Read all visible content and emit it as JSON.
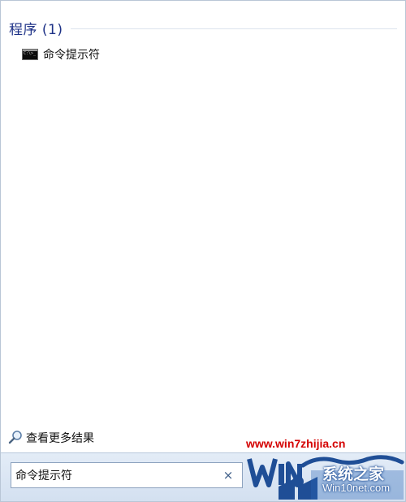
{
  "results": {
    "group_title": "程序 (1)",
    "items": [
      {
        "label": "命令提示符",
        "icon": "command-prompt-icon"
      }
    ],
    "see_more_label": "查看更多结果"
  },
  "search": {
    "value": "命令提示符",
    "clear_symbol": "×"
  },
  "watermark": {
    "url": "www.win7zhijia.cn",
    "brand": "系统之家",
    "domain": "Win10net.com"
  },
  "colors": {
    "group_title": "#1e3287",
    "watermark_url": "#d40000",
    "logo_blue": "#1f4e96"
  }
}
